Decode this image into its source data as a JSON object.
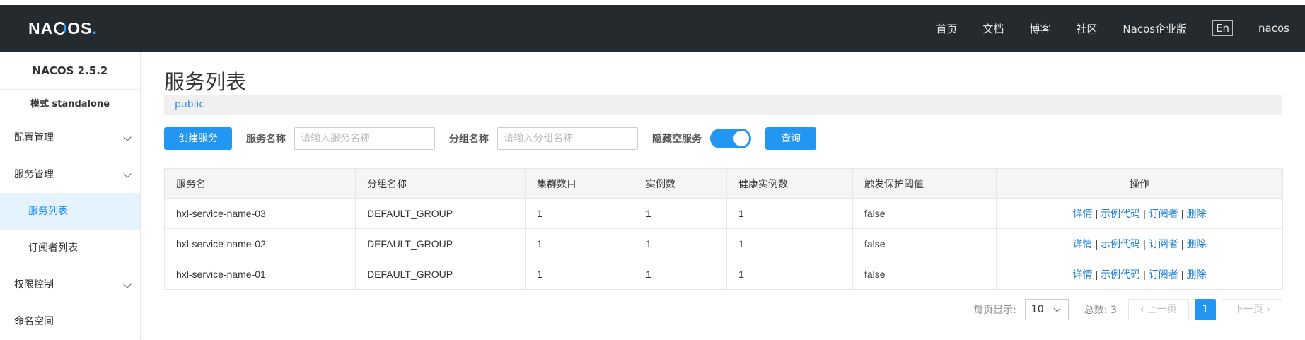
{
  "header": {
    "logo_text": "NACOS",
    "nav": [
      "首页",
      "文档",
      "博客",
      "社区",
      "Nacos企业版",
      "En",
      "nacos"
    ]
  },
  "sidebar": {
    "version": "NACOS 2.5.2",
    "mode": "模式 standalone",
    "items": [
      {
        "label": "配置管理"
      },
      {
        "label": "服务管理"
      },
      {
        "label": "服务列表"
      },
      {
        "label": "订阅者列表"
      },
      {
        "label": "权限控制"
      },
      {
        "label": "命名空间"
      }
    ]
  },
  "main": {
    "title": "服务列表",
    "namespace": "public",
    "create_button": "创建服务",
    "service_name_label": "服务名称",
    "service_name_placeholder": "请输入服务名称",
    "group_name_label": "分组名称",
    "group_name_placeholder": "请输入分组名称",
    "hide_empty_label": "隐藏空服务",
    "hide_empty_on": true,
    "query_button": "查询",
    "columns": [
      "服务名",
      "分组名称",
      "集群数目",
      "实例数",
      "健康实例数",
      "触发保护阈值",
      "操作"
    ],
    "rows": [
      {
        "name": "hxl-service-name-03",
        "group": "DEFAULT_GROUP",
        "clusters": "1",
        "instances": "1",
        "healthy": "1",
        "threshold": "false"
      },
      {
        "name": "hxl-service-name-02",
        "group": "DEFAULT_GROUP",
        "clusters": "1",
        "instances": "1",
        "healthy": "1",
        "threshold": "false"
      },
      {
        "name": "hxl-service-name-01",
        "group": "DEFAULT_GROUP",
        "clusters": "1",
        "instances": "1",
        "healthy": "1",
        "threshold": "false"
      }
    ],
    "actions": [
      "详情",
      "示例代码",
      "订阅者",
      "删除"
    ],
    "action_separator": "|",
    "pager": {
      "page_size_label": "每页显示:",
      "page_size": "10",
      "total_label": "总数: 3",
      "prev": "上一页",
      "current_page": "1",
      "next": "下一页"
    }
  },
  "colors": {
    "header_bg": "#252a2f",
    "primary": "#2196f3",
    "link": "#1a7fd9",
    "active_bg": "#e5f3ff"
  }
}
